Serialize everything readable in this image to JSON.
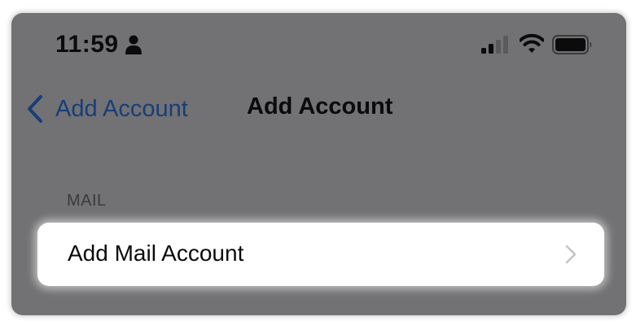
{
  "status_bar": {
    "time": "11:59",
    "icons": [
      "person-icon",
      "cellular-signal-icon",
      "wifi-icon",
      "battery-icon"
    ]
  },
  "nav": {
    "back_label": "Add Account",
    "title": "Add Account"
  },
  "section": {
    "header": "MAIL",
    "items": [
      {
        "label": "Add Mail Account",
        "icon": "chevron-right-icon"
      }
    ]
  },
  "colors": {
    "background_dimmed": "#727173",
    "accent_link": "#173e7a",
    "text_primary": "#0b0b0b",
    "card": "#ffffff"
  }
}
